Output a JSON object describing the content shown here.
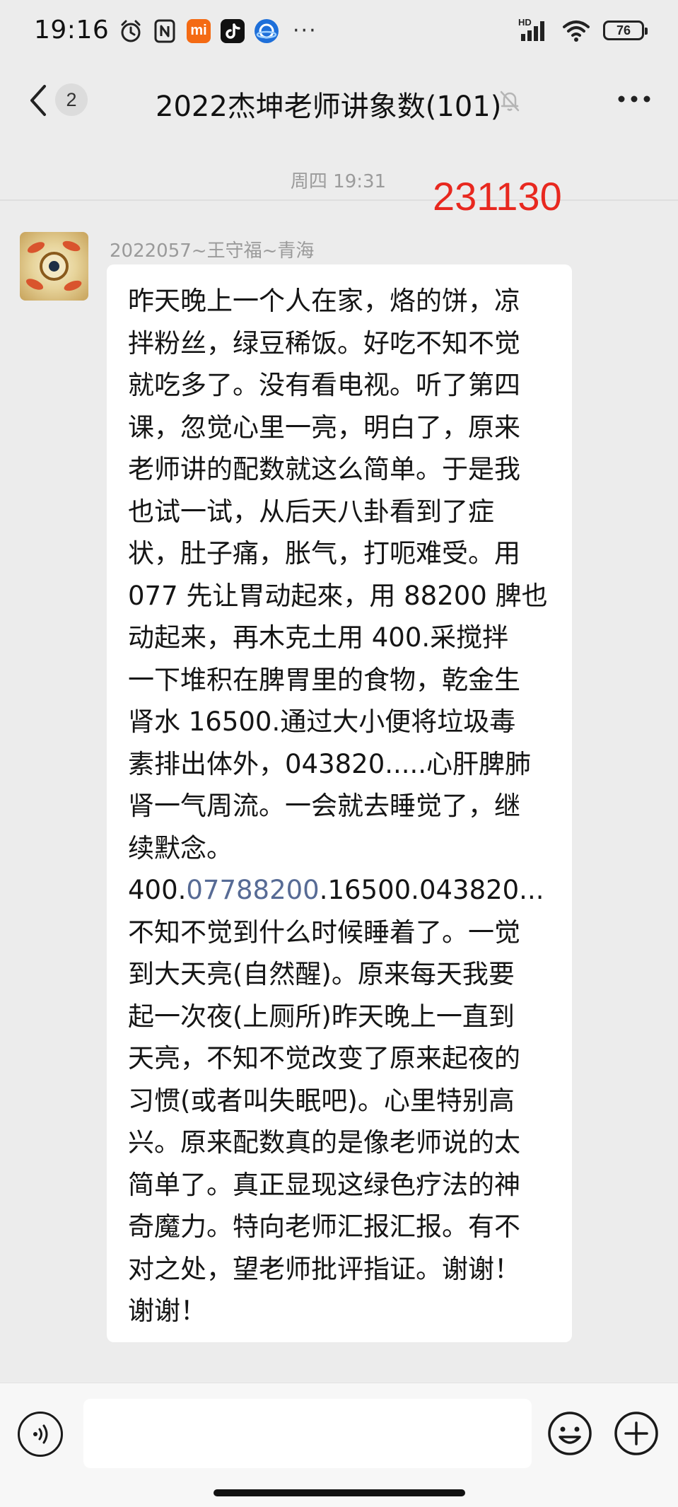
{
  "status_bar": {
    "time": "19:16",
    "more": "···",
    "network_label": "HD",
    "battery": "76",
    "icons": [
      "alarm-icon",
      "nfc-icon",
      "mi-app-icon",
      "tiktok-icon",
      "browser-app-icon",
      "signal-icon",
      "wifi-icon",
      "battery-icon"
    ],
    "mi_label": "mi"
  },
  "header": {
    "unread_count": "2",
    "title": "2022杰坤老师讲象数(101)",
    "icons": [
      "back-icon",
      "mute-bell-icon",
      "more-icon"
    ]
  },
  "chat": {
    "timestamp": "周四 19:31",
    "annotation": "231130",
    "annotation_color": "#e8281f",
    "sender": "2022057~王守福~青海",
    "message": {
      "l1": "昨天晚上一个人在家，烙的饼，凉",
      "l2": "拌粉丝，绿豆稀饭。好吃不知不觉",
      "l3": "就吃多了。没有看电视。听了第四",
      "l4": "课，忽觉心里一亮，明白了，原来",
      "l5": "老师讲的配数就这么简单。于是我",
      "l6": "也试一试，从后天八卦看到了症",
      "l7": "状，肚子痛，胀气，打呃难受。用",
      "l8": "077 先让胃动起來，用 88200 脾也",
      "l9": "动起来，再木克土用 400.采搅拌",
      "l10": "一下堆积在脾胃里的食物，乾金生",
      "l11": "肾水 16500.通过大小便将垃圾毒",
      "l12": "素排出体外，043820.....心肝脾肺",
      "l13": "肾一气周流。一会就去睡觉了，继",
      "l14": "续默念。",
      "l15_pre": "400.",
      "l15_link": "07788200",
      "l15_post": ".16500.043820...",
      "l16": "不知不觉到什么时候睡着了。一觉",
      "l17": "到大天亮(自然醒)。原来每天我要",
      "l18": "起一次夜(上厕所)昨天晚上一直到",
      "l19": "天亮，不知不觉改变了原来起夜的",
      "l20": "习惯(或者叫失眠吧)。心里特别高",
      "l21": "兴。原来配数真的是像老师说的太",
      "l22": "简单了。真正显现这绿色疗法的神",
      "l23": "奇魔力。特向老师汇报汇报。有不",
      "l24": "对之处，望老师批评指证。谢谢！",
      "l25": "谢谢！"
    },
    "link_color": "#576b95"
  },
  "input_bar": {
    "text_value": "",
    "icons": [
      "voice-icon",
      "emoji-icon",
      "plus-icon"
    ]
  }
}
